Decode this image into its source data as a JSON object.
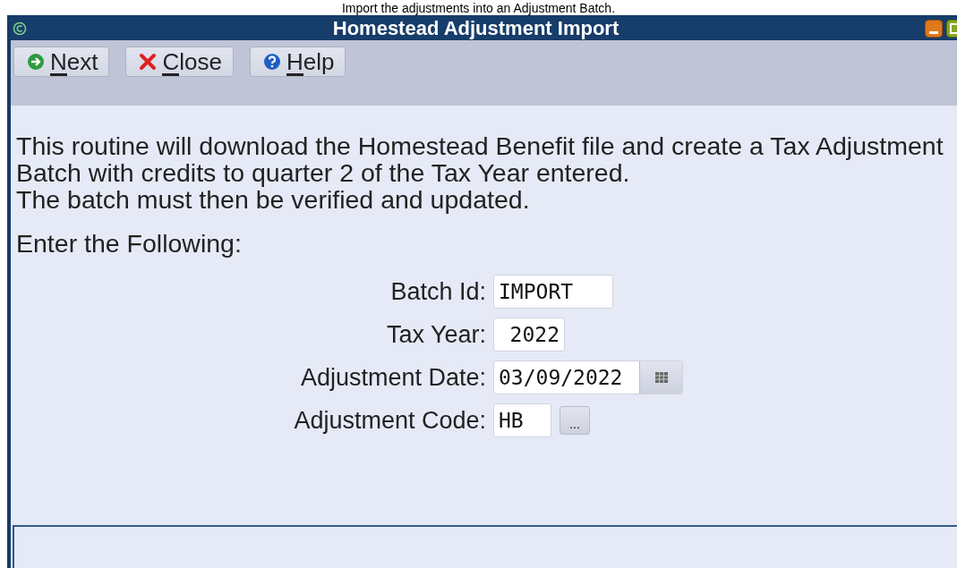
{
  "caption": "Import the adjustments into an Adjustment Batch.",
  "window": {
    "title": "Homestead Adjustment Import"
  },
  "toolbar": [
    {
      "label": "Next",
      "kind": "next"
    },
    {
      "label": "Close",
      "kind": "close"
    },
    {
      "label": "Help",
      "kind": "help"
    }
  ],
  "description": [
    "This routine will download the Homestead Benefit file and create a Tax Adjustment",
    "Batch with credits to quarter 2 of the Tax Year entered.",
    "The batch must then be verified and updated."
  ],
  "prompt": "Enter the Following:",
  "fields": [
    {
      "label": "Batch Id:",
      "value": "IMPORT",
      "kind": "text"
    },
    {
      "label": "Tax Year:",
      "value": "2022",
      "kind": "year"
    },
    {
      "label": "Adjustment Date:",
      "value": "03/09/2022",
      "kind": "date"
    },
    {
      "label": "Adjustment Code:",
      "value": "HB",
      "kind": "lookup",
      "button_label": "..."
    }
  ]
}
